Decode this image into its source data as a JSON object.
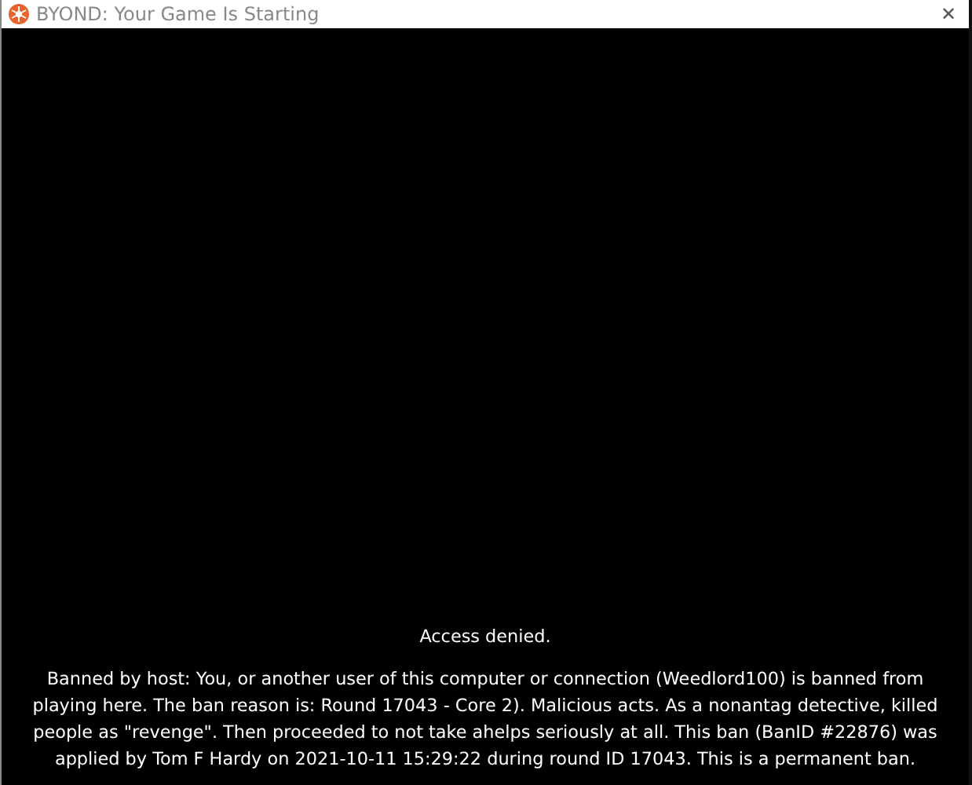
{
  "window": {
    "title": "BYOND: Your Game Is Starting",
    "close": "✕"
  },
  "message": {
    "heading": "Access denied.",
    "body": "Banned by host: You, or another user of this computer or connection (Weedlord100) is banned from playing here. The ban reason is: Round 17043 - Core 2). Malicious acts. As a nonantag detective, killed people as \"revenge\". Then proceeded to not take ahelps seriously at all. This ban (BanID #22876) was applied by Tom F Hardy on 2021-10-11 15:29:22 during round ID 17043. This is a permanent ban."
  }
}
